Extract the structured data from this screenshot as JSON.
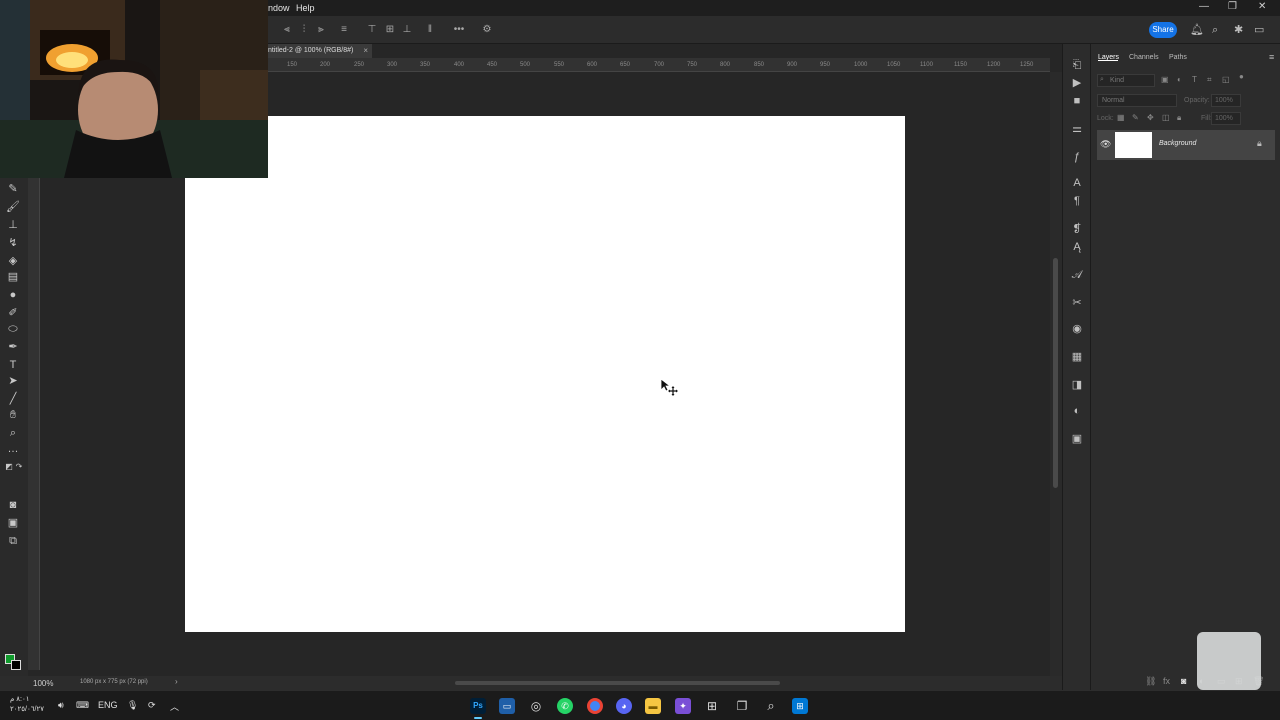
{
  "menubar": {
    "items": [
      "ndow",
      "Help"
    ],
    "window_controls": [
      "—",
      "❐",
      "✕"
    ]
  },
  "optionsbar": {
    "more_label": "•••",
    "share_label": "Share"
  },
  "document": {
    "tab_title": "ntitled-2 @ 100% (RGB/8#)",
    "close_label": "×",
    "canvas_color": "#ffffff"
  },
  "ruler": {
    "labels": [
      "150",
      "200",
      "250",
      "300",
      "350",
      "400",
      "450",
      "500",
      "550",
      "600",
      "650",
      "700",
      "750",
      "800",
      "850",
      "900",
      "950",
      "1000",
      "1050",
      "1100",
      "1150",
      "1200",
      "1250"
    ]
  },
  "colors": {
    "foreground": "#109b2d",
    "background": "#000000",
    "accent": "#1473e6"
  },
  "statusbar": {
    "zoom": "100%",
    "doc_info": "1080 px x 775 px (72 ppi)",
    "arrow": "›"
  },
  "panels": {
    "tabs": [
      "Layers",
      "Channels",
      "Paths"
    ],
    "active_tab": "Layers",
    "kind_placeholder": "Kind",
    "blend_mode": "Normal",
    "opacity_label": "Opacity:",
    "opacity_value": "100%",
    "lock_label": "Lock:",
    "fill_label": "Fill:",
    "fill_value": "100%",
    "layer": {
      "name": "Background"
    }
  },
  "taskbar": {
    "language": "ENG",
    "clock_time": "٨:٠١ م",
    "clock_date": "٢٠٢٥/٠٦/٢٧"
  }
}
